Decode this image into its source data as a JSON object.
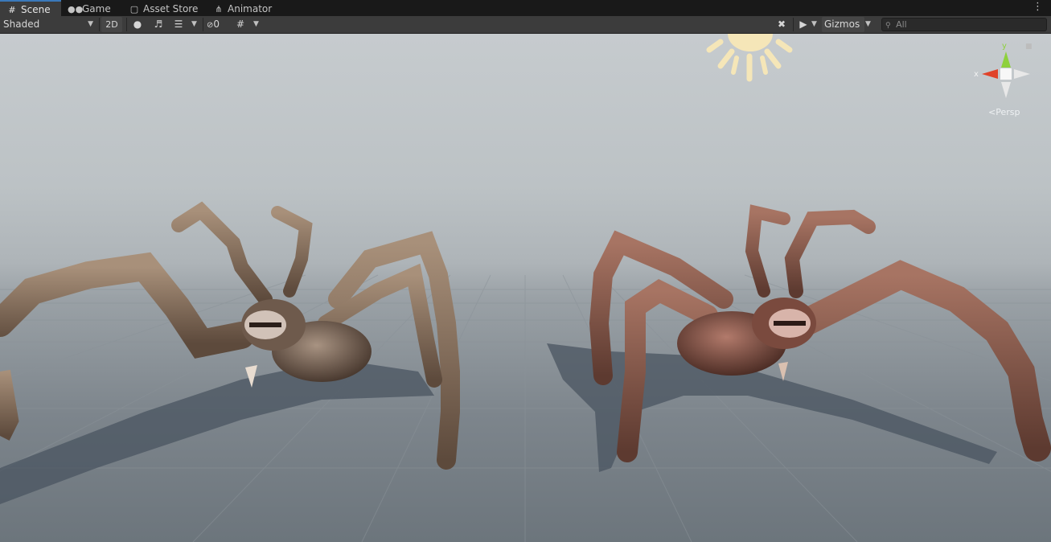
{
  "tabs": [
    {
      "label": "Scene",
      "icon": "grid-icon",
      "active": true
    },
    {
      "label": "Game",
      "icon": "gamepad-icon",
      "active": false
    },
    {
      "label": "Asset Store",
      "icon": "bag-icon",
      "active": false
    },
    {
      "label": "Animator",
      "icon": "animator-icon",
      "active": false
    }
  ],
  "toolbar": {
    "draw_mode": "Shaded",
    "mode_2d": "2D",
    "hidden_count": "0",
    "gizmos_label": "Gizmos",
    "search_placeholder": "All"
  },
  "viewport": {
    "projection_label": "Persp",
    "axis_x": "x",
    "axis_y": "y",
    "colors": {
      "x_axis": "#e0432a",
      "y_axis": "#8ed13d",
      "sky": "#c6cbce",
      "ground": "#7d858c",
      "spider_left": "#7a6450",
      "spider_right": "#8a5a4a",
      "light_icon": "#f5e6b8"
    }
  }
}
